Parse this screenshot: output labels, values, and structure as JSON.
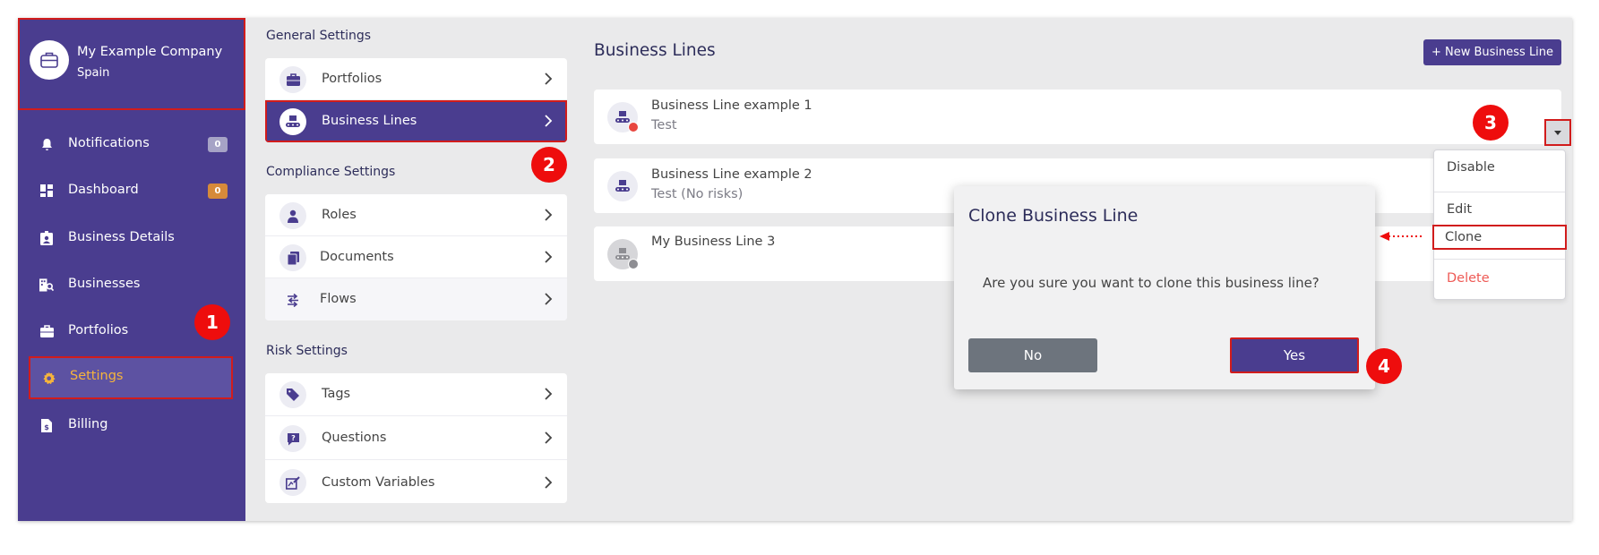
{
  "company": {
    "name": "My Example Company",
    "country": "Spain",
    "icon": "briefcase-icon"
  },
  "sidebar": {
    "items": [
      {
        "label": "Notifications",
        "icon": "bell-icon",
        "badge": "0",
        "badge_color": "#a6a3c6"
      },
      {
        "label": "Dashboard",
        "icon": "dashboard-icon",
        "badge": "0",
        "badge_color": "#d68a3a"
      },
      {
        "label": "Business Details",
        "icon": "id-badge-icon"
      },
      {
        "label": "Businesses",
        "icon": "building-search-icon"
      },
      {
        "label": "Portfolios",
        "icon": "briefcase-icon"
      },
      {
        "label": "Settings",
        "icon": "gear-icon",
        "active": true
      },
      {
        "label": "Billing",
        "icon": "invoice-icon"
      }
    ]
  },
  "settings": {
    "general": {
      "title": "General Settings",
      "items": [
        {
          "label": "Portfolios",
          "icon": "briefcase-icon"
        },
        {
          "label": "Business Lines",
          "icon": "conveyor-icon",
          "active": true
        }
      ]
    },
    "compliance": {
      "title": "Compliance Settings",
      "items": [
        {
          "label": "Roles",
          "icon": "user-tie-icon"
        },
        {
          "label": "Documents",
          "icon": "documents-icon"
        },
        {
          "label": "Flows",
          "icon": "flow-icon"
        }
      ]
    },
    "risk": {
      "title": "Risk Settings",
      "items": [
        {
          "label": "Tags",
          "icon": "tag-icon"
        },
        {
          "label": "Questions",
          "icon": "question-bubble-icon"
        },
        {
          "label": "Custom Variables",
          "icon": "edit-chart-icon"
        }
      ]
    }
  },
  "main": {
    "title": "Business Lines",
    "new_button": "+ New Business Line",
    "business_lines": [
      {
        "name": "Business Line example 1",
        "description": "Test",
        "status_color": "#e8463f"
      },
      {
        "name": "Business Line example 2",
        "description": "Test (No risks)"
      },
      {
        "name": "My Business Line 3",
        "description": "",
        "disabled": true
      }
    ]
  },
  "dropdown": {
    "items": [
      {
        "label": "Disable"
      },
      {
        "label": "Edit"
      },
      {
        "label": "Clone",
        "highlighted": true
      },
      {
        "label": "Delete",
        "danger": true
      }
    ]
  },
  "modal": {
    "title": "Clone Business Line",
    "message": "Are you sure you want to clone this business line?",
    "no_label": "No",
    "yes_label": "Yes"
  },
  "steps": [
    "1",
    "2",
    "3",
    "4"
  ],
  "colors": {
    "primary": "#4a3d8f",
    "highlight": "#d11c1c",
    "active_text": "#f6b43c",
    "danger": "#ee5a55"
  }
}
